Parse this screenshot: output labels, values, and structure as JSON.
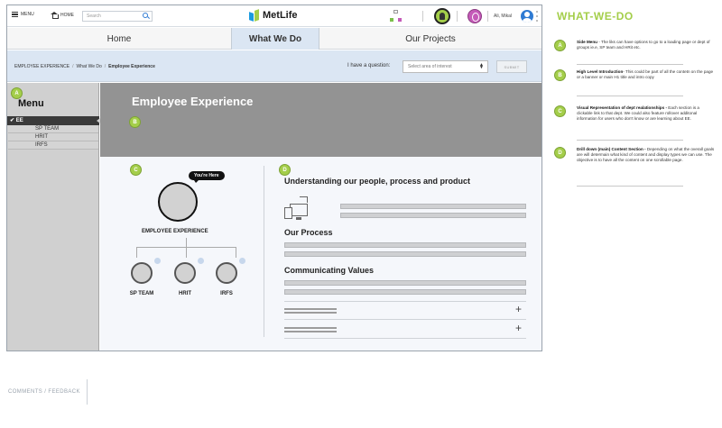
{
  "header": {
    "menu_label": "MENU",
    "home_label": "HOME",
    "search_placeholder": "Search",
    "brand": "MetLife",
    "user_name": "Ali, Mikal"
  },
  "nav": {
    "tabs": [
      {
        "label": "Home",
        "active": false
      },
      {
        "label": "What We Do",
        "active": true
      },
      {
        "label": "Our Projects",
        "active": false
      }
    ]
  },
  "breadcrumb": {
    "items": [
      "EMPLOYEE EXPERIENCE",
      "What We Do",
      "Employee Experience"
    ],
    "separator": "/"
  },
  "question": {
    "label": "I have a question:",
    "select_value": "Select area of interest",
    "submit_label": "SUBMIT"
  },
  "sidebar": {
    "title": "Menu",
    "active_item": "EE",
    "active_check": "✔",
    "sub_items": [
      "SP TEAM",
      "HRIT",
      "IRFS"
    ]
  },
  "hero": {
    "title": "Employee Experience"
  },
  "org": {
    "here_tag": "You're Here",
    "root_label": "EMPLOYEE EXPERIENCE",
    "children": [
      "SP TEAM",
      "HRIT",
      "IRFS"
    ]
  },
  "content": {
    "section1_title": "Understanding our people, process and product",
    "section2_title": "Our Process",
    "section3_title": "Communicating Values",
    "plus_symbol": "+"
  },
  "badges": {
    "a": "A",
    "b": "B",
    "c": "C",
    "d": "D"
  },
  "annotations": {
    "title": "WHAT-WE-DO",
    "items": [
      {
        "badge": "A",
        "heading": "Side Menu",
        "text": " - The liks can have options to go to a loading page or dept of groups ie.e, SP team and HRit etc."
      },
      {
        "badge": "B",
        "heading": "High Level Introduction",
        "text": "- This could be part of all the contetn on the page or a banner or main H1 title and intro copy"
      },
      {
        "badge": "C",
        "heading": "Visual Representation of dept realationships -",
        "text": " Each section is a clickable link to that dept.  We could also feature rollover additonal information for users who don't know or are learning about EE."
      },
      {
        "badge": "D",
        "heading": "Drill down (main) Content Section -",
        "text": " Depending on what the overall goals are will determain what kind of content and display types we can use.  The objective is to have all the content on one scrollable page."
      }
    ]
  },
  "footer": {
    "feedback_label": "COMMENTS / FEEDBACK"
  },
  "colors": {
    "accent_green": "#a4ce4a",
    "hero_gray": "#939393",
    "nav_active": "#dbe6f3",
    "brand_blue": "#1a9be0"
  }
}
